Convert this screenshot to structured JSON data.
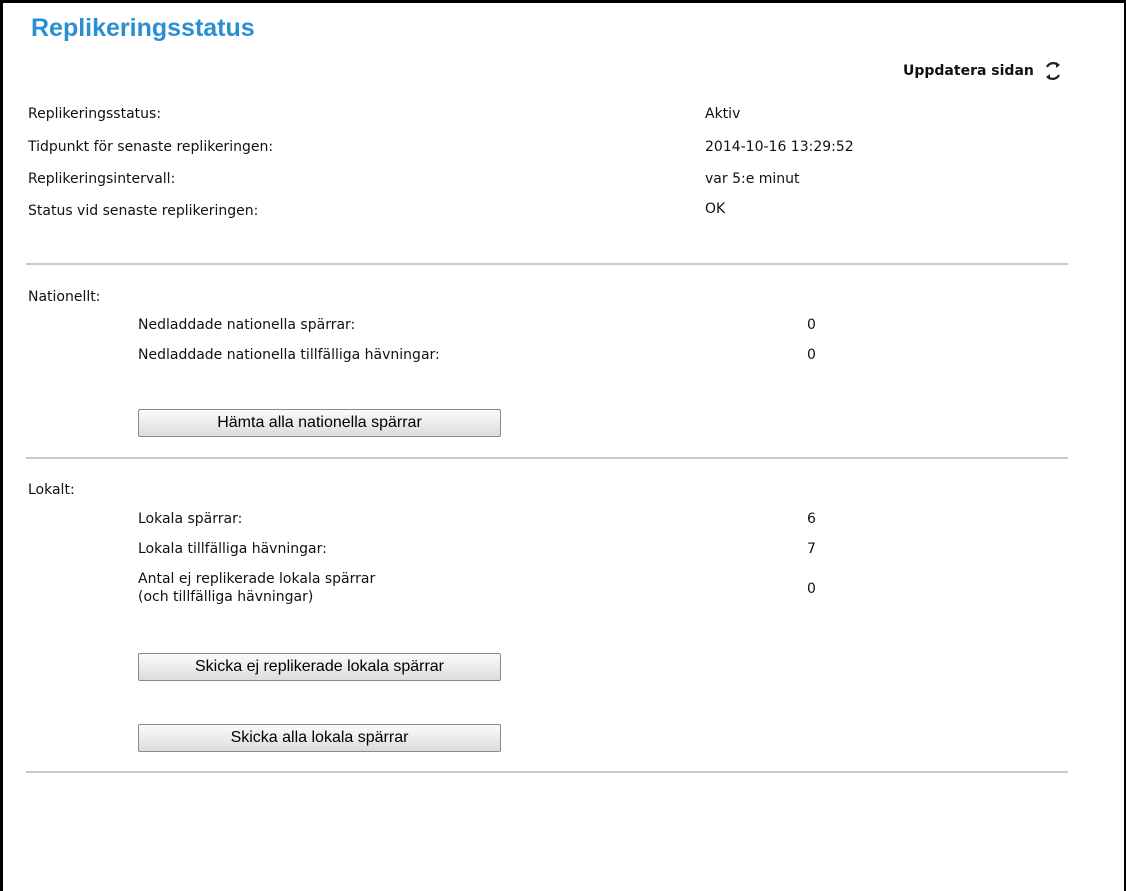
{
  "page": {
    "title": "Replikeringsstatus",
    "refresh_label": "Uppdatera sidan"
  },
  "status": [
    {
      "label": "Replikeringsstatus:",
      "value": "Aktiv"
    },
    {
      "label": "Tidpunkt för senaste replikeringen:",
      "value": "2014-10-16 13:29:52"
    },
    {
      "label": "Replikeringsintervall:",
      "value": "var 5:e minut"
    },
    {
      "label": "Status vid senaste replikeringen:",
      "value": "OK"
    }
  ],
  "national": {
    "heading": "Nationellt:",
    "rows": [
      {
        "label": "Nedladdade nationella spärrar:",
        "value": "0"
      },
      {
        "label": "Nedladdade nationella tillfälliga hävningar:",
        "value": "0"
      }
    ],
    "button": "Hämta alla nationella spärrar"
  },
  "local": {
    "heading": "Lokalt:",
    "rows": [
      {
        "label": "Lokala spärrar:",
        "value": "6"
      },
      {
        "label": "Lokala tillfälliga hävningar:",
        "value": "7"
      },
      {
        "label": "Antal ej replikerade lokala spärrar",
        "label2": "(och tillfälliga hävningar)",
        "value": "0"
      }
    ],
    "button_send_unreplicated": "Skicka ej replikerade lokala spärrar",
    "button_send_all": "Skicka alla lokala spärrar"
  }
}
